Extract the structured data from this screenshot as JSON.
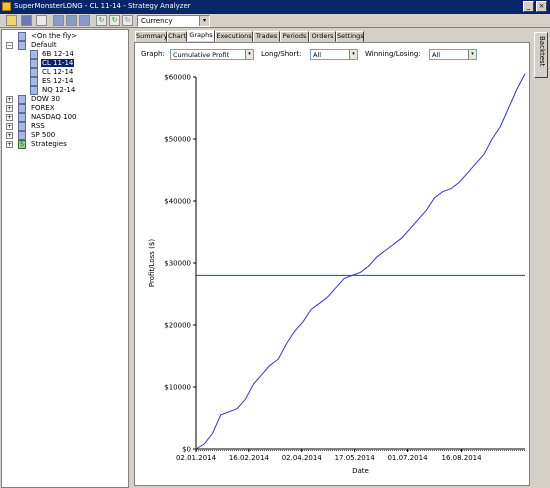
{
  "window": {
    "title": "SuperMonsterLONG - CL 11-14 - Strategy Analyzer",
    "minimize_glyph": "_",
    "close_glyph": "×"
  },
  "toolbar": {
    "buttons": [
      "folder-open-icon",
      "save-icon",
      "copy-icon",
      "grid-icon",
      "grid-icon",
      "grid-icon",
      "refresh-icon",
      "refresh-icon",
      "refresh-icon"
    ],
    "view_select": "Currency",
    "dropdown_glyph": "▾"
  },
  "tree": {
    "expand_minus": "−",
    "expand_plus": "+",
    "strategy_glyph": "S",
    "on_the_fly": "<On the fly>",
    "default": "Default",
    "instruments": [
      "6B 12-14",
      "CL 11-14",
      "CL 12-14",
      "ES 12-14",
      "NQ 12-14"
    ],
    "selected_index": 1,
    "groups": [
      "DOW 30",
      "FOREX",
      "NASDAQ 100",
      "RSS",
      "SP 500",
      "Strategies"
    ]
  },
  "tabs": [
    "Summary",
    "Chart",
    "Graphs",
    "Executions",
    "Trades",
    "Periods",
    "Orders",
    "Settings"
  ],
  "active_tab": "Graphs",
  "filters": {
    "graph_label": "Graph:",
    "graph_value": "Cumulative Profit",
    "long_short_label": "Long/Short:",
    "long_short_value": "All",
    "winning_losing_label": "Winning/Losing:",
    "winning_losing_value": "All"
  },
  "side_tab": "Backtest",
  "chart_data": {
    "type": "line",
    "title": "",
    "xlabel": "Date",
    "ylabel": "Profit/Loss ($)",
    "x_ticks": [
      "02.01.2014",
      "16.02.2014",
      "02.04.2014",
      "17.05.2014",
      "01.07.2014",
      "16.08.2014"
    ],
    "y_ticks": [
      "$0",
      "$10000",
      "$20000",
      "$30000",
      "$40000",
      "$50000",
      "$60000"
    ],
    "ylim": [
      0,
      60000
    ],
    "line_color": "#3333cc",
    "horizontal_line": 28000,
    "series": [
      {
        "x": [
          "02.01.2014",
          "09.01.2014",
          "16.01.2014",
          "23.01.2014",
          "30.01.2014",
          "06.02.2014",
          "13.02.2014",
          "20.02.2014",
          "27.02.2014",
          "06.03.2014",
          "13.03.2014",
          "20.03.2014",
          "27.03.2014",
          "03.04.2014",
          "10.04.2014",
          "17.04.2014",
          "24.04.2014",
          "01.05.2014",
          "08.05.2014",
          "15.05.2014",
          "22.05.2014",
          "29.05.2014",
          "05.06.2014",
          "12.06.2014",
          "19.06.2014",
          "26.06.2014",
          "03.07.2014",
          "10.07.2014",
          "17.07.2014",
          "24.07.2014",
          "31.07.2014",
          "07.08.2014",
          "14.08.2014",
          "21.08.2014",
          "28.08.2014",
          "04.09.2014",
          "11.09.2014",
          "18.09.2014",
          "25.09.2014",
          "02.10.2014",
          "09.10.2014"
        ],
        "values": [
          0,
          800,
          2500,
          5500,
          6000,
          6500,
          8000,
          10500,
          12000,
          13500,
          14500,
          17000,
          19000,
          20500,
          22500,
          23500,
          24500,
          26000,
          27500,
          28000,
          28500,
          29500,
          31000,
          32000,
          33000,
          34000,
          35500,
          37000,
          38500,
          40500,
          41500,
          42000,
          43000,
          44500,
          46000,
          47500,
          50000,
          52000,
          55000,
          58000,
          60500
        ]
      }
    ]
  }
}
